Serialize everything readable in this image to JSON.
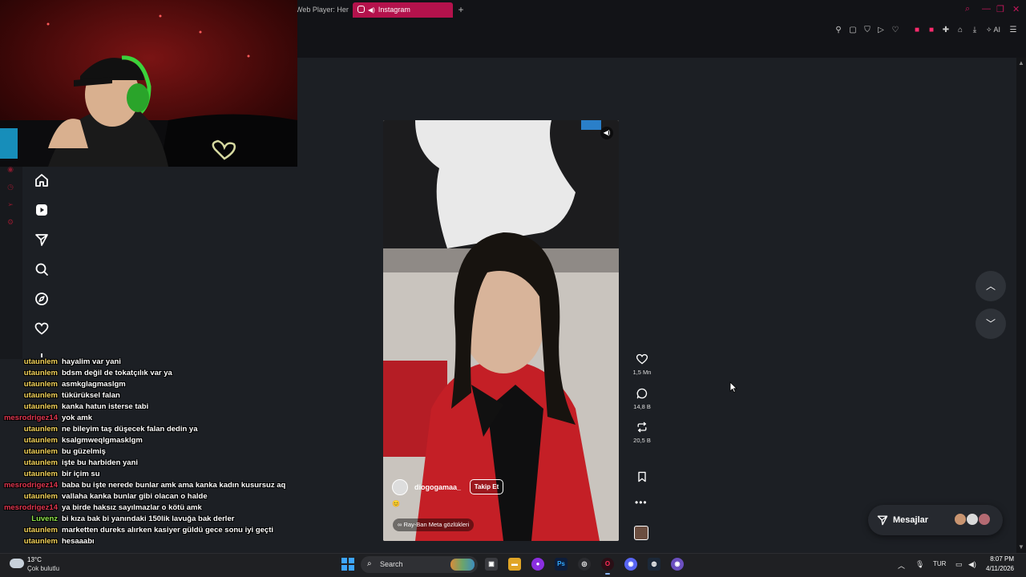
{
  "browser": {
    "tabs": [
      {
        "label": "Web Player: Her"
      },
      {
        "label": "Instagram"
      }
    ],
    "new_tab_label": "+",
    "ai_label": "AI"
  },
  "sidebar": {
    "items": [
      {
        "name": "home-icon"
      },
      {
        "name": "reels-icon"
      },
      {
        "name": "messages-icon"
      },
      {
        "name": "search-icon"
      },
      {
        "name": "explore-icon"
      },
      {
        "name": "notifications-icon"
      },
      {
        "name": "create-icon"
      }
    ]
  },
  "reel": {
    "username": "diogogamaa_",
    "follow_label": "Takip Et",
    "tag": "Ray-Ban Meta gözlükleri",
    "tag_icon": "∞",
    "emoji": "😊"
  },
  "actions": {
    "likes": "1,5 Mn",
    "comments": "14,8 B",
    "reposts": "20,5 B"
  },
  "messages": {
    "label": "Mesajlar"
  },
  "chat": [
    {
      "user": "utaunlem",
      "msg": "hayalim var yani",
      "color": "#f3d35a"
    },
    {
      "user": "utaunlem",
      "msg": "bdsm değil de tokatçılık var ya",
      "color": "#f3d35a"
    },
    {
      "user": "utaunlem",
      "msg": "asmkglagmaslgm",
      "color": "#f3d35a"
    },
    {
      "user": "utaunlem",
      "msg": "tükürüksel falan",
      "color": "#f3d35a"
    },
    {
      "user": "utaunlem",
      "msg": "kanka hatun isterse tabi",
      "color": "#f3d35a"
    },
    {
      "user": "mesrodrigez14",
      "msg": "yok amk",
      "color": "#e0364f"
    },
    {
      "user": "utaunlem",
      "msg": "ne bileyim taş düşecek falan dedin ya",
      "color": "#f3d35a"
    },
    {
      "user": "utaunlem",
      "msg": "ksalgmweqlgmasklgm",
      "color": "#f3d35a"
    },
    {
      "user": "utaunlem",
      "msg": "bu güzelmiş",
      "color": "#f3d35a"
    },
    {
      "user": "utaunlem",
      "msg": "işte bu harbiden yani",
      "color": "#f3d35a"
    },
    {
      "user": "utaunlem",
      "msg": "bir içim su",
      "color": "#f3d35a"
    },
    {
      "user": "mesrodrigez14",
      "msg": "baba bu işte nerede bunlar amk ama kanka kadın kusursuz aq",
      "color": "#e0364f"
    },
    {
      "user": "utaunlem",
      "msg": "vallaha kanka bunlar gibi olacan o halde",
      "color": "#f3d35a"
    },
    {
      "user": "mesrodrigez14",
      "msg": "ya birde haksız sayılmazlar o kötü amk",
      "color": "#e0364f"
    },
    {
      "user": "Luvenz",
      "msg": "bi kıza bak bi yanındaki 150lik lavuğa bak derler",
      "color": "#8ee44a"
    },
    {
      "user": "utaunlem",
      "msg": "marketten dureks alırken kasiyer güldü gece sonu iyi geçti",
      "color": "#f3d35a"
    },
    {
      "user": "utaunlem",
      "msg": "hesaaabı",
      "color": "#f3d35a"
    }
  ],
  "taskbar": {
    "weather_temp": "13°C",
    "weather_desc": "Çok bulutlu",
    "search_label": "Search",
    "lang": "TUR",
    "time": "8:07 PM",
    "date": "4/11/2026"
  },
  "colors": {
    "accent": "#b4124c",
    "page_bg": "#1c1f24",
    "chrome_bg": "#121317"
  }
}
